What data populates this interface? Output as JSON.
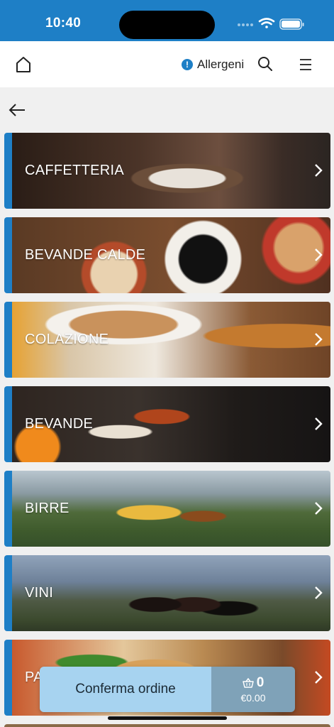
{
  "status_bar": {
    "time": "10:40",
    "background": "#1e7fc6"
  },
  "nav": {
    "home_icon": "home-icon",
    "allergens_badge": "!",
    "allergens_label": "Allergeni",
    "search_icon": "search-icon",
    "menu_icon": "hamburger-menu-icon"
  },
  "back_icon": "arrow-left-icon",
  "accent_color": "#1e7fc6",
  "categories": [
    {
      "label": "CAFFETTERIA"
    },
    {
      "label": "BEVANDE CALDE"
    },
    {
      "label": "COLAZIONE"
    },
    {
      "label": "BEVANDE"
    },
    {
      "label": "BIRRE"
    },
    {
      "label": "VINI"
    },
    {
      "label": "PA"
    }
  ],
  "order": {
    "confirm_label": "Conferma ordine",
    "cart_icon": "basket-icon",
    "item_count": "0",
    "total": "€0.00"
  }
}
